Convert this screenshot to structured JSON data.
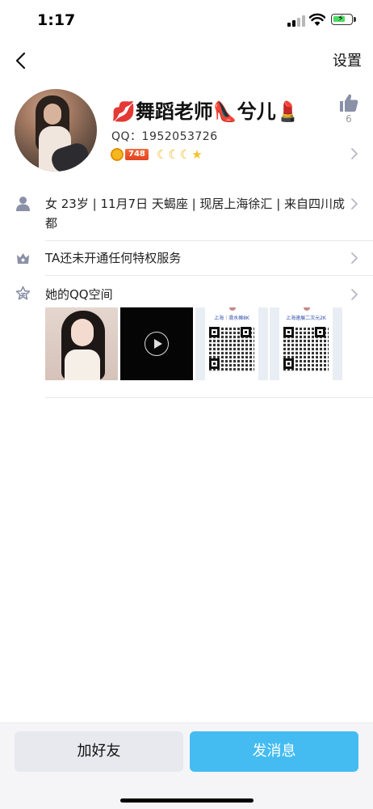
{
  "status_bar": {
    "time": "1:17",
    "battery_level": 0.5,
    "battery_color": "#4cd964"
  },
  "nav": {
    "back_icon": "chevron-left-icon",
    "settings_label": "设置"
  },
  "profile": {
    "avatar_icon": "user-photo",
    "nickname": "💋舞蹈老师👠兮儿💄",
    "qq_label": "QQ：",
    "qq_number": "1952053726",
    "likes": "6",
    "vip_level": "748",
    "level_icons": [
      "moon-icon",
      "moon-icon",
      "moon-icon",
      "star-icon"
    ]
  },
  "info": {
    "text": "女 23岁 | 11月7日 天蝎座 | 现居上海徐汇 | 来自四川成都"
  },
  "vip": {
    "label": "TA还未开通任何特权服务"
  },
  "qzone": {
    "label": "她的QQ空间",
    "photos": [
      {
        "type": "photo"
      },
      {
        "type": "video"
      },
      {
        "type": "qr-card",
        "title": "上海｜滑水摊8K"
      },
      {
        "type": "qr-card",
        "title": "上海速展二次元2K"
      }
    ]
  },
  "actions": {
    "add_friend": "加好友",
    "send_message": "发消息"
  },
  "colors": {
    "accent": "#44bcf2",
    "secondary_button": "#e8e9ef",
    "icon_gray": "#8a90a6"
  }
}
